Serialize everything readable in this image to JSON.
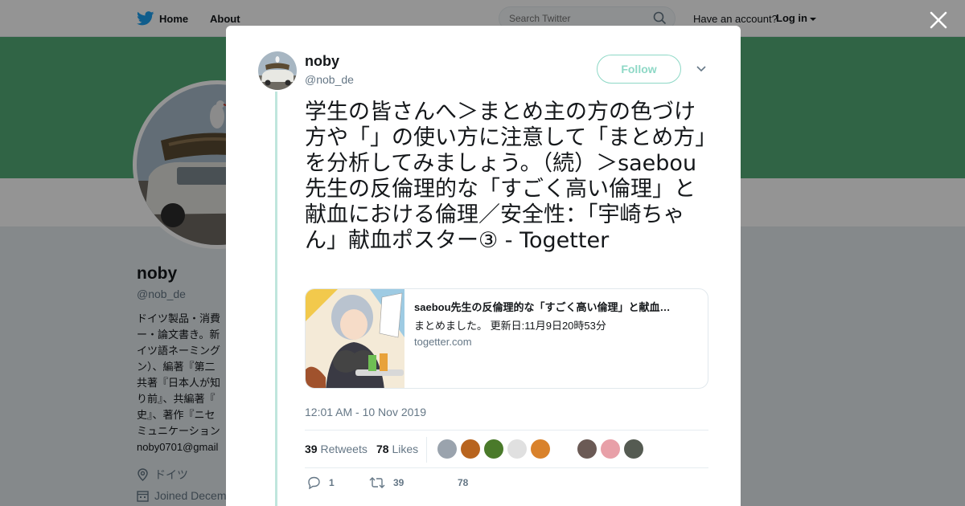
{
  "topbar": {
    "home_label": "Home",
    "about_label": "About",
    "search_placeholder": "Search Twitter",
    "have_account": "Have an account?",
    "login_label": "Log in"
  },
  "profile": {
    "name": "noby",
    "handle": "@nob_de",
    "bio": "ドイツ製品・消費\nー・論文書き。新\nイツ語ネーミング\nン）、編著『第二\n共著『日本人が知\nり前』、共編著『\n史』、著作『ニセ\nミュニケーション",
    "email": "noby0701@gmail",
    "location": "ドイツ",
    "joined": "Joined Decem",
    "banner_color": "#53ac78"
  },
  "modal": {
    "author_name": "noby",
    "author_handle": "@nob_de",
    "follow_label": "Follow",
    "accent_color": "#8ed8c6",
    "tweet_text": "学生の皆さんへ＞まとめ主の方の色づけ方や「」の使い方に注意して「まとめ方」を分析してみましょう。（続）＞saebou先生の反倫理的な「すごく高い倫理」と献血における倫理／安全性：「宇崎ちゃん」献血ポスター③ - Togetter",
    "card": {
      "title": "saebou先生の反倫理的な「すごく高い倫理」と献血…",
      "description": "まとめました。 更新日:11月9日20時53分",
      "domain": "togetter.com"
    },
    "timestamp": "12:01 AM - 10 Nov 2019",
    "retweets_count": "39",
    "retweets_label": "Retweets",
    "likes_count": "78",
    "likes_label": "Likes",
    "likers": [
      "#9aa3ad",
      "#b8641e",
      "#4a7a2a",
      "#e0e0e0",
      "#d9822b",
      "#ffffff",
      "#6b5a55",
      "#e8a0a8",
      "#555b52"
    ],
    "actions": {
      "reply_count": "1",
      "retweet_count": "39",
      "like_count": "78"
    }
  }
}
